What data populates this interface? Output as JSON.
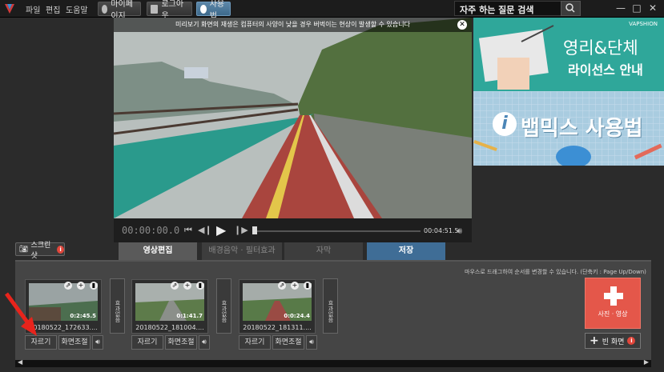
{
  "menu": {
    "file": "파일",
    "edit": "편집",
    "help": "도움말"
  },
  "toolbar": {
    "mypage": "마이페이지",
    "logout": "로그아웃",
    "usage": "사용법"
  },
  "search": {
    "label": "자주 하는 질문 검색"
  },
  "preview": {
    "banner": "미리보기 화면의 재생은 컴퓨터의 사양이 낮을 경우 버벅이는 현상이 발생할 수 있습니다",
    "current_time": "00:00:00.0",
    "total_time": "00:04:51.5"
  },
  "ads": {
    "ad1_line1": "영리&단체",
    "ad1_line2": "라이선스 안내",
    "ad2_title": "뱁믹스 사용법",
    "brand": "VAPSHION"
  },
  "screenshot_label": "스크린샷",
  "tabs": [
    {
      "label": "영상편집",
      "state": "active"
    },
    {
      "label": "배경음악 · 필터효과",
      "state": "inactive"
    },
    {
      "label": "자막",
      "state": "inactive"
    },
    {
      "label": "저장",
      "state": "save"
    }
  ],
  "hint": "마우스로 드래그하여 순서를 변경할 수 있습니다. (단축키 : Page Up/Down)",
  "clips": [
    {
      "name": "20180522_172633....",
      "duration": "0:2:45.5",
      "cut": "자르기",
      "resize": "화면조절"
    },
    {
      "name": "20180522_181004....",
      "duration": "0:1:41.7",
      "cut": "자르기",
      "resize": "화면조절"
    },
    {
      "name": "20180522_181311....",
      "duration": "0:0:24.4",
      "cut": "자르기",
      "resize": "화면조절"
    }
  ],
  "effect_label": "효과없음",
  "add_media": "사진 · 영상",
  "blank_screen": "빈 화면",
  "colors": {
    "accent": "#3f6d96",
    "add": "#e4574a",
    "arrow": "#e8241c"
  }
}
